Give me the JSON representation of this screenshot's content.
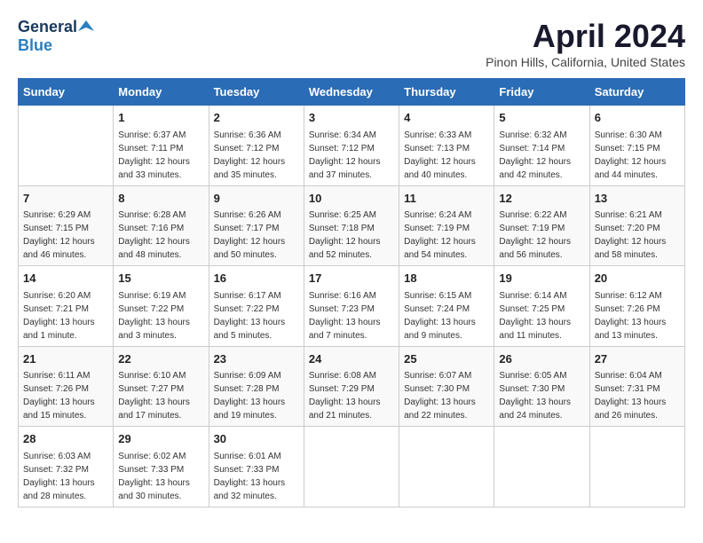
{
  "logo": {
    "line1": "General",
    "line2": "Blue"
  },
  "title": "April 2024",
  "subtitle": "Pinon Hills, California, United States",
  "days_header": [
    "Sunday",
    "Monday",
    "Tuesday",
    "Wednesday",
    "Thursday",
    "Friday",
    "Saturday"
  ],
  "weeks": [
    [
      {
        "day": "",
        "info": ""
      },
      {
        "day": "1",
        "info": "Sunrise: 6:37 AM\nSunset: 7:11 PM\nDaylight: 12 hours\nand 33 minutes."
      },
      {
        "day": "2",
        "info": "Sunrise: 6:36 AM\nSunset: 7:12 PM\nDaylight: 12 hours\nand 35 minutes."
      },
      {
        "day": "3",
        "info": "Sunrise: 6:34 AM\nSunset: 7:12 PM\nDaylight: 12 hours\nand 37 minutes."
      },
      {
        "day": "4",
        "info": "Sunrise: 6:33 AM\nSunset: 7:13 PM\nDaylight: 12 hours\nand 40 minutes."
      },
      {
        "day": "5",
        "info": "Sunrise: 6:32 AM\nSunset: 7:14 PM\nDaylight: 12 hours\nand 42 minutes."
      },
      {
        "day": "6",
        "info": "Sunrise: 6:30 AM\nSunset: 7:15 PM\nDaylight: 12 hours\nand 44 minutes."
      }
    ],
    [
      {
        "day": "7",
        "info": "Sunrise: 6:29 AM\nSunset: 7:15 PM\nDaylight: 12 hours\nand 46 minutes."
      },
      {
        "day": "8",
        "info": "Sunrise: 6:28 AM\nSunset: 7:16 PM\nDaylight: 12 hours\nand 48 minutes."
      },
      {
        "day": "9",
        "info": "Sunrise: 6:26 AM\nSunset: 7:17 PM\nDaylight: 12 hours\nand 50 minutes."
      },
      {
        "day": "10",
        "info": "Sunrise: 6:25 AM\nSunset: 7:18 PM\nDaylight: 12 hours\nand 52 minutes."
      },
      {
        "day": "11",
        "info": "Sunrise: 6:24 AM\nSunset: 7:19 PM\nDaylight: 12 hours\nand 54 minutes."
      },
      {
        "day": "12",
        "info": "Sunrise: 6:22 AM\nSunset: 7:19 PM\nDaylight: 12 hours\nand 56 minutes."
      },
      {
        "day": "13",
        "info": "Sunrise: 6:21 AM\nSunset: 7:20 PM\nDaylight: 12 hours\nand 58 minutes."
      }
    ],
    [
      {
        "day": "14",
        "info": "Sunrise: 6:20 AM\nSunset: 7:21 PM\nDaylight: 13 hours\nand 1 minute."
      },
      {
        "day": "15",
        "info": "Sunrise: 6:19 AM\nSunset: 7:22 PM\nDaylight: 13 hours\nand 3 minutes."
      },
      {
        "day": "16",
        "info": "Sunrise: 6:17 AM\nSunset: 7:22 PM\nDaylight: 13 hours\nand 5 minutes."
      },
      {
        "day": "17",
        "info": "Sunrise: 6:16 AM\nSunset: 7:23 PM\nDaylight: 13 hours\nand 7 minutes."
      },
      {
        "day": "18",
        "info": "Sunrise: 6:15 AM\nSunset: 7:24 PM\nDaylight: 13 hours\nand 9 minutes."
      },
      {
        "day": "19",
        "info": "Sunrise: 6:14 AM\nSunset: 7:25 PM\nDaylight: 13 hours\nand 11 minutes."
      },
      {
        "day": "20",
        "info": "Sunrise: 6:12 AM\nSunset: 7:26 PM\nDaylight: 13 hours\nand 13 minutes."
      }
    ],
    [
      {
        "day": "21",
        "info": "Sunrise: 6:11 AM\nSunset: 7:26 PM\nDaylight: 13 hours\nand 15 minutes."
      },
      {
        "day": "22",
        "info": "Sunrise: 6:10 AM\nSunset: 7:27 PM\nDaylight: 13 hours\nand 17 minutes."
      },
      {
        "day": "23",
        "info": "Sunrise: 6:09 AM\nSunset: 7:28 PM\nDaylight: 13 hours\nand 19 minutes."
      },
      {
        "day": "24",
        "info": "Sunrise: 6:08 AM\nSunset: 7:29 PM\nDaylight: 13 hours\nand 21 minutes."
      },
      {
        "day": "25",
        "info": "Sunrise: 6:07 AM\nSunset: 7:30 PM\nDaylight: 13 hours\nand 22 minutes."
      },
      {
        "day": "26",
        "info": "Sunrise: 6:05 AM\nSunset: 7:30 PM\nDaylight: 13 hours\nand 24 minutes."
      },
      {
        "day": "27",
        "info": "Sunrise: 6:04 AM\nSunset: 7:31 PM\nDaylight: 13 hours\nand 26 minutes."
      }
    ],
    [
      {
        "day": "28",
        "info": "Sunrise: 6:03 AM\nSunset: 7:32 PM\nDaylight: 13 hours\nand 28 minutes."
      },
      {
        "day": "29",
        "info": "Sunrise: 6:02 AM\nSunset: 7:33 PM\nDaylight: 13 hours\nand 30 minutes."
      },
      {
        "day": "30",
        "info": "Sunrise: 6:01 AM\nSunset: 7:33 PM\nDaylight: 13 hours\nand 32 minutes."
      },
      {
        "day": "",
        "info": ""
      },
      {
        "day": "",
        "info": ""
      },
      {
        "day": "",
        "info": ""
      },
      {
        "day": "",
        "info": ""
      }
    ]
  ]
}
